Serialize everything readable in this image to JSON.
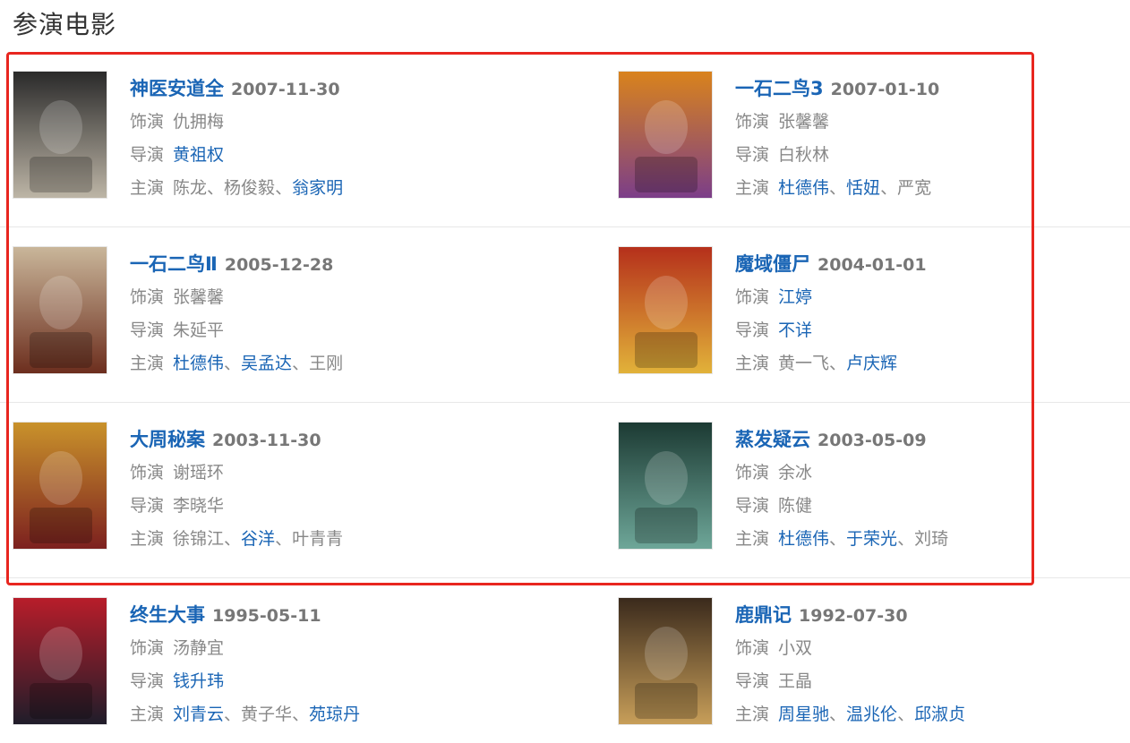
{
  "section_title": "参演电影",
  "labels": {
    "role": "饰演",
    "director": "导演",
    "cast": "主演"
  },
  "movies": [
    {
      "title": "神医安道全",
      "date": "2007-11-30",
      "role": {
        "name": "仇拥梅",
        "link": false
      },
      "director": [
        {
          "name": "黄祖权",
          "link": true
        }
      ],
      "cast": [
        {
          "name": "陈龙",
          "link": false
        },
        {
          "name": "杨俊毅",
          "link": false
        },
        {
          "name": "翁家明",
          "link": true
        }
      ],
      "poster_colors": [
        "#2a2a2a",
        "#bfb7a8"
      ]
    },
    {
      "title": "一石二鸟3",
      "date": "2007-01-10",
      "role": {
        "name": "张馨馨",
        "link": false
      },
      "director": [
        {
          "name": "白秋林",
          "link": false
        }
      ],
      "cast": [
        {
          "name": "杜德伟",
          "link": true
        },
        {
          "name": "恬妞",
          "link": true
        },
        {
          "name": "严宽",
          "link": false
        }
      ],
      "poster_colors": [
        "#d9831c",
        "#7a3d8a"
      ]
    },
    {
      "title": "一石二鸟Ⅱ",
      "date": "2005-12-28",
      "role": {
        "name": "张馨馨",
        "link": false
      },
      "director": [
        {
          "name": "朱延平",
          "link": false
        }
      ],
      "cast": [
        {
          "name": "杜德伟",
          "link": true
        },
        {
          "name": "吴孟达",
          "link": true
        },
        {
          "name": "王刚",
          "link": false
        }
      ],
      "poster_colors": [
        "#c9b69a",
        "#6b2c1c"
      ]
    },
    {
      "title": "魔域僵尸",
      "date": "2004-01-01",
      "role": {
        "name": "江婷",
        "link": true
      },
      "director": [
        {
          "name": "不详",
          "link": true
        }
      ],
      "cast": [
        {
          "name": "黄一飞",
          "link": false
        },
        {
          "name": "卢庆辉",
          "link": true
        }
      ],
      "poster_colors": [
        "#b5301b",
        "#e2b43a"
      ]
    },
    {
      "title": "大周秘案",
      "date": "2003-11-30",
      "role": {
        "name": "谢瑶环",
        "link": false
      },
      "director": [
        {
          "name": "李晓华",
          "link": false
        }
      ],
      "cast": [
        {
          "name": "徐锦江",
          "link": false
        },
        {
          "name": "谷洋",
          "link": true
        },
        {
          "name": "叶青青",
          "link": false
        }
      ],
      "poster_colors": [
        "#c9922b",
        "#7b1f1f"
      ]
    },
    {
      "title": "蒸发疑云",
      "date": "2003-05-09",
      "role": {
        "name": "余冰",
        "link": false
      },
      "director": [
        {
          "name": "陈健",
          "link": false
        }
      ],
      "cast": [
        {
          "name": "杜德伟",
          "link": true
        },
        {
          "name": "于荣光",
          "link": true
        },
        {
          "name": "刘琦",
          "link": false
        }
      ],
      "poster_colors": [
        "#1c3a33",
        "#6fa89a"
      ]
    },
    {
      "title": "终生大事",
      "date": "1995-05-11",
      "role": {
        "name": "汤静宜",
        "link": false
      },
      "director": [
        {
          "name": "钱升玮",
          "link": true
        }
      ],
      "cast": [
        {
          "name": "刘青云",
          "link": true
        },
        {
          "name": "黄子华",
          "link": false
        },
        {
          "name": "苑琼丹",
          "link": true
        }
      ],
      "poster_colors": [
        "#b81d2a",
        "#1d1d2a"
      ]
    },
    {
      "title": "鹿鼎记",
      "date": "1992-07-30",
      "role": {
        "name": "小双",
        "link": false
      },
      "director": [
        {
          "name": "王晶",
          "link": false
        }
      ],
      "cast": [
        {
          "name": "周星驰",
          "link": true
        },
        {
          "name": "温兆伦",
          "link": true
        },
        {
          "name": "邱淑贞",
          "link": true
        }
      ],
      "poster_colors": [
        "#3a2a1c",
        "#c9a05a"
      ]
    }
  ]
}
